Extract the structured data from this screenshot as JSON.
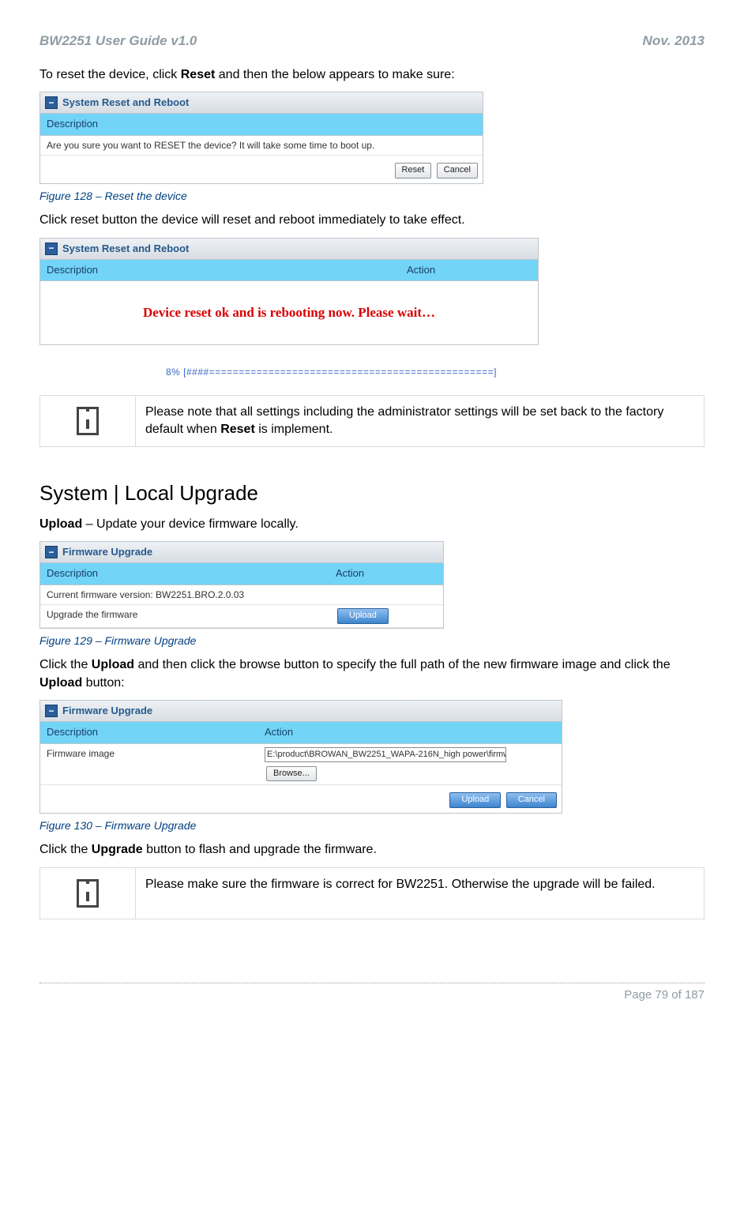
{
  "header": {
    "left": "BW2251 User Guide v1.0",
    "right": "Nov.  2013"
  },
  "p1_a": "To reset the device, click ",
  "p1_b": "Reset",
  "p1_c": " and then the below appears to make sure:",
  "fig128": {
    "title": "System Reset and Reboot",
    "hdr_desc": "Description",
    "q": "Are you sure you want to RESET the device? It will take some time to boot up.",
    "btn_reset": "Reset",
    "btn_cancel": "Cancel"
  },
  "cap128": "Figure 128 – Reset the device",
  "p2": "Click reset button the device will reset and reboot immediately to take effect.",
  "fig128b": {
    "title": "System Reset and Reboot",
    "hdr_desc": "Description",
    "hdr_action": "Action",
    "msg": "Device reset ok and is rebooting now. Please wait…",
    "progress": "8% [####================================================]"
  },
  "note1_a": "Please note that all settings including the administrator settings will be set back to the factory default when ",
  "note1_b": "Reset",
  "note1_c": " is implement.",
  "section": "System | Local Upgrade",
  "p3_a": "Upload",
  "p3_b": " – Update your device firmware locally.",
  "fig129": {
    "title": "Firmware Upgrade",
    "hdr_desc": "Description",
    "hdr_action": "Action",
    "row1": "Current firmware version: BW2251.BRO.2.0.03",
    "row2": "Upgrade the firmware",
    "btn_upload": "Upload"
  },
  "cap129": "Figure 129 – Firmware Upgrade",
  "p4_a": "Click the ",
  "p4_b": "Upload",
  "p4_c": " and then click the browse button to specify the full path of the new firmware image and click the ",
  "p4_d": "Upload",
  "p4_e": " button:",
  "fig130": {
    "title": "Firmware Upgrade",
    "hdr_desc": "Description",
    "hdr_action": "Action",
    "row_label": "Firmware image",
    "path": "E:\\product\\BROWAN_BW2251_WAPA-216N_high power\\firmw",
    "btn_browse": "Browse...",
    "btn_upload": "Upload",
    "btn_cancel": "Cancel"
  },
  "cap130": "Figure 130 – Firmware Upgrade",
  "p5_a": "Click the ",
  "p5_b": "Upgrade",
  "p5_c": " button to flash and upgrade the firmware.",
  "note2": "Please make sure the firmware is correct for BW2251. Otherwise the upgrade will be failed.",
  "footer": "Page 79 of 187"
}
